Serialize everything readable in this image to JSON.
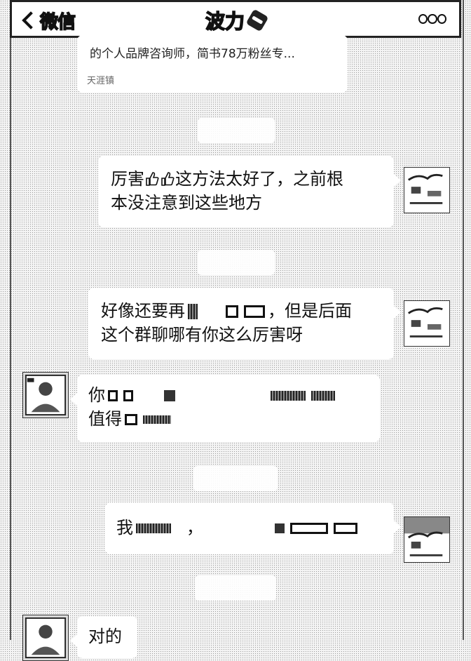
{
  "nav": {
    "back_label": "微信",
    "title": "波力"
  },
  "card": {
    "description": "的个人品牌咨询师，简书78万粉丝专...",
    "source": "天涯镇"
  },
  "messages": [
    {
      "side": "right",
      "text_a": "厉害",
      "text_b": "这方法太好了，之前根",
      "text_c": "本没注意到这些地方"
    },
    {
      "side": "right",
      "text_a": "好像还要再",
      "text_b": "，但是后面",
      "text_c": "这个群聊哪有你这么厉害呀"
    },
    {
      "side": "left",
      "text_a": "你",
      "text_b": "值得"
    },
    {
      "side": "right",
      "text_a": "我",
      "text_b": "，"
    },
    {
      "side": "left",
      "text_a": "对的"
    }
  ],
  "icons": {
    "thumb": "thumbs-up-icon"
  },
  "colors": {
    "bubble": "#ffffff",
    "background": "#f4f4f4"
  }
}
